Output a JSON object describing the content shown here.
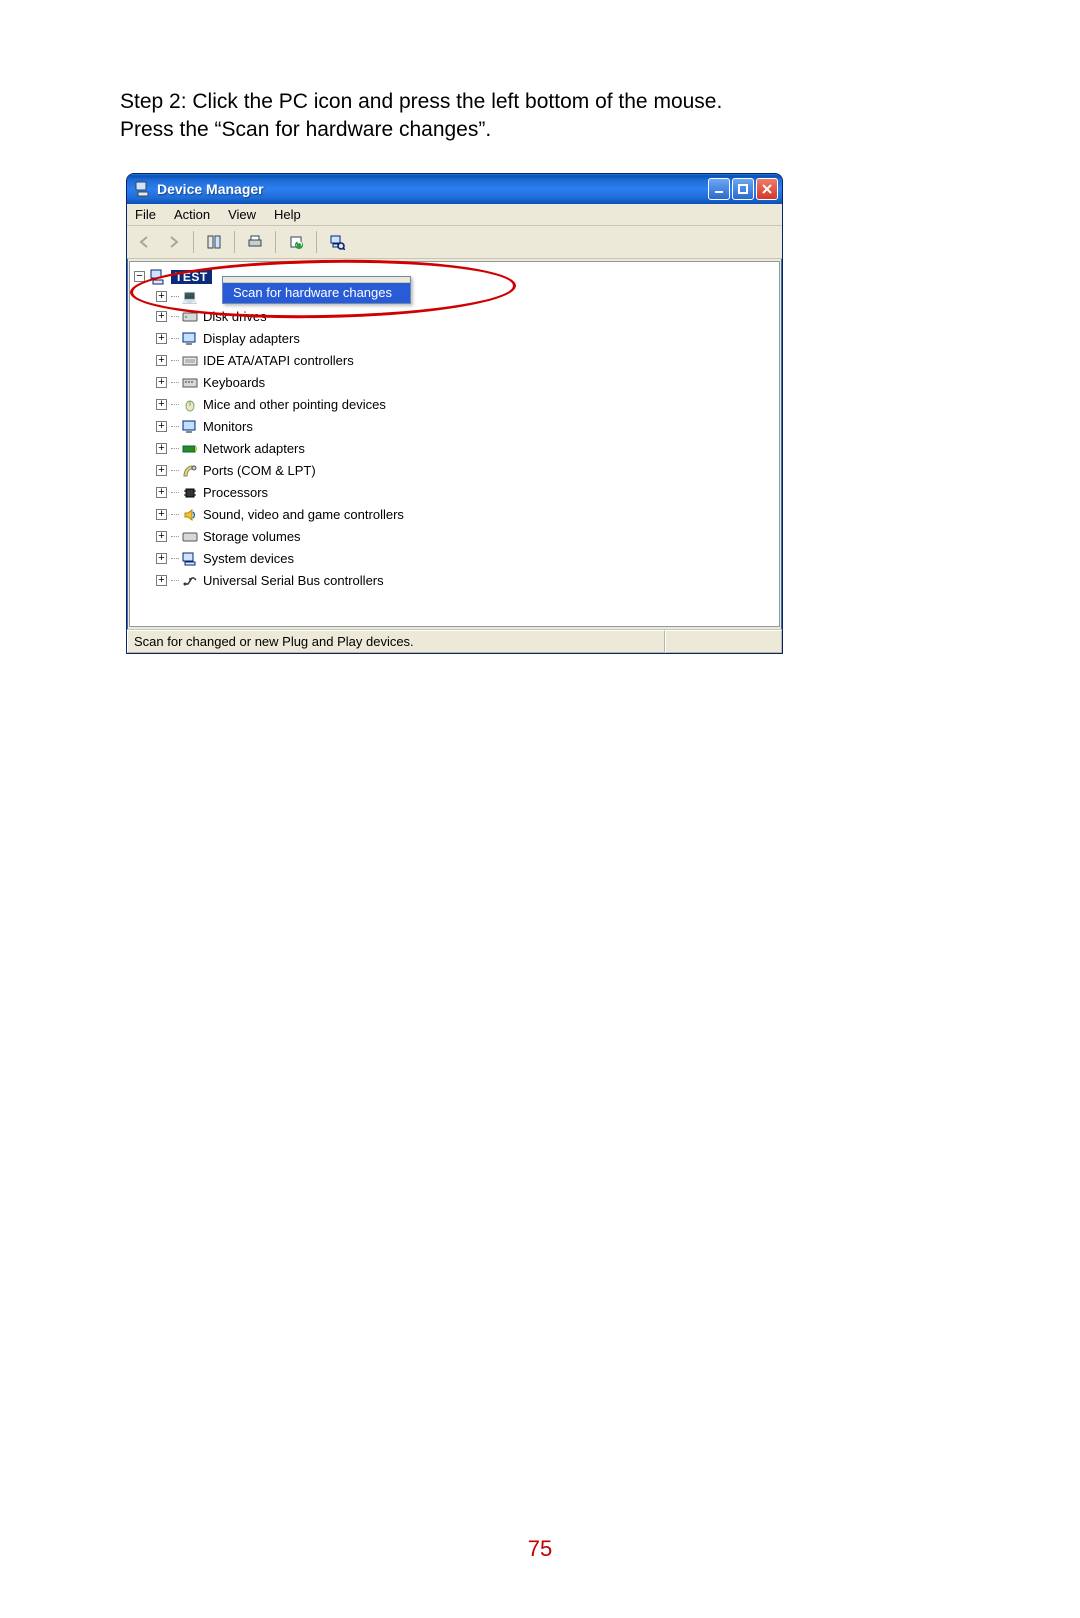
{
  "instruction_line1": "Step 2: Click the PC icon and press the left bottom of the mouse.",
  "instruction_line2": "Press the “Scan for hardware changes”.",
  "page_number": "75",
  "window": {
    "title": "Device Manager",
    "menu": {
      "file": "File",
      "action": "Action",
      "view": "View",
      "help": "Help"
    },
    "root_label_partial": "TEST",
    "context_menu_item": "Scan for hardware changes",
    "statusbar_text": "Scan for changed or new Plug and Play devices.",
    "tree": [
      {
        "label": "Disk drives"
      },
      {
        "label": "Display adapters"
      },
      {
        "label": "IDE ATA/ATAPI controllers"
      },
      {
        "label": "Keyboards"
      },
      {
        "label": "Mice and other pointing devices"
      },
      {
        "label": "Monitors"
      },
      {
        "label": "Network adapters"
      },
      {
        "label": "Ports (COM & LPT)"
      },
      {
        "label": "Processors"
      },
      {
        "label": "Sound, video and game controllers"
      },
      {
        "label": "Storage volumes"
      },
      {
        "label": "System devices"
      },
      {
        "label": "Universal Serial Bus controllers"
      }
    ]
  }
}
